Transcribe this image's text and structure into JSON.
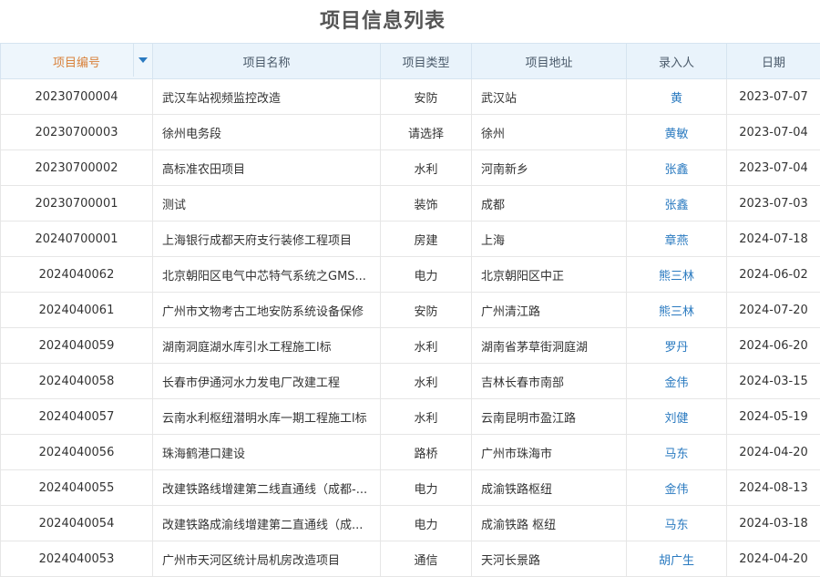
{
  "title": "项目信息列表",
  "columns": [
    "项目编号",
    "项目名称",
    "项目类型",
    "项目地址",
    "录入人",
    "日期"
  ],
  "rows": [
    [
      "20230700004",
      "武汉车站视频监控改造",
      "安防",
      "武汉站",
      "黄",
      "2023-07-07"
    ],
    [
      "20230700003",
      "徐州电务段",
      "请选择",
      "徐州",
      "黄敏",
      "2023-07-04"
    ],
    [
      "20230700002",
      "高标准农田项目",
      "水利",
      "河南新乡",
      "张鑫",
      "2023-07-04"
    ],
    [
      "20230700001",
      "测试",
      "装饰",
      "成都",
      "张鑫",
      "2023-07-03"
    ],
    [
      "20240700001",
      "上海银行成都天府支行装修工程项目",
      "房建",
      "上海",
      "章燕",
      "2024-07-18"
    ],
    [
      "2024040062",
      "北京朝阳区电气中芯特气系统之GMS...",
      "电力",
      "北京朝阳区中正",
      "熊三林",
      "2024-06-02"
    ],
    [
      "2024040061",
      "广州市文物考古工地安防系统设备保修",
      "安防",
      "广州清江路",
      "熊三林",
      "2024-07-20"
    ],
    [
      "2024040059",
      "湖南洞庭湖水库引水工程施工l标",
      "水利",
      "湖南省茅草街洞庭湖",
      "罗丹",
      "2024-06-20"
    ],
    [
      "2024040058",
      "长春市伊通河水力发电厂改建工程",
      "水利",
      "吉林长春市南部",
      "金伟",
      "2024-03-15"
    ],
    [
      "2024040057",
      "云南水利枢纽潜明水库一期工程施工l标",
      "水利",
      "云南昆明市盈江路",
      "刘健",
      "2024-05-19"
    ],
    [
      "2024040056",
      "珠海鹤港口建设",
      "路桥",
      "广州市珠海市",
      "马东",
      "2024-04-20"
    ],
    [
      "2024040055",
      "改建铁路线增建第二线直通线（成都-...",
      "电力",
      "成渝铁路枢纽",
      "金伟",
      "2024-08-13"
    ],
    [
      "2024040054",
      "改建铁路成渝线增建第二直通线（成...",
      "电力",
      "成渝铁路 枢纽",
      "马东",
      "2024-03-18"
    ],
    [
      "2024040053",
      "广州市天河区统计局机房改造项目",
      "通信",
      "天河长景路",
      "胡广生",
      "2024-04-20"
    ]
  ]
}
